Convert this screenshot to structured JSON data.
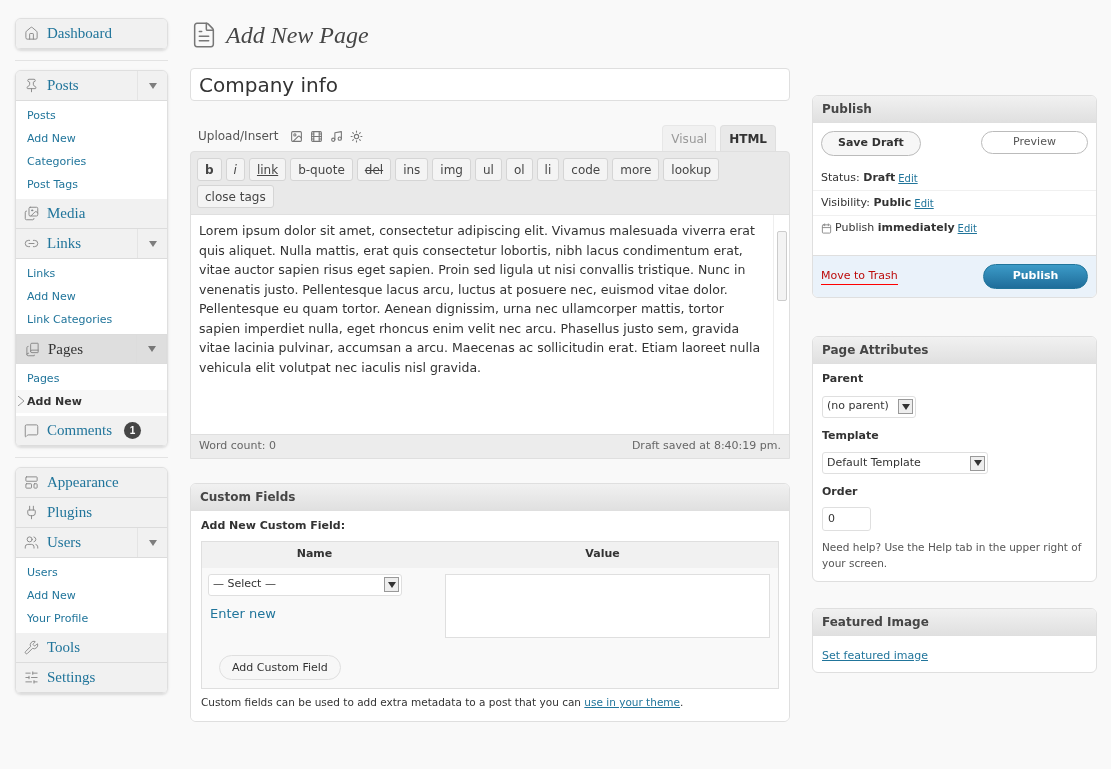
{
  "sidebar": {
    "groups": [
      [
        {
          "label": "Dashboard",
          "selected": false
        }
      ],
      [
        {
          "label": "Posts",
          "selected": false,
          "expanded": true,
          "children": [
            {
              "label": "Posts",
              "selected": false
            },
            {
              "label": "Add New",
              "selected": false
            },
            {
              "label": "Categories",
              "selected": false
            },
            {
              "label": "Post Tags",
              "selected": false
            }
          ]
        },
        {
          "label": "Media",
          "selected": false
        },
        {
          "label": "Links",
          "selected": false,
          "expanded": true,
          "children": [
            {
              "label": "Links",
              "selected": false
            },
            {
              "label": "Add New",
              "selected": false
            },
            {
              "label": "Link Categories",
              "selected": false
            }
          ]
        },
        {
          "label": "Pages",
          "selected": true,
          "expanded": true,
          "children": [
            {
              "label": "Pages",
              "selected": false
            },
            {
              "label": "Add New",
              "selected": true
            }
          ]
        },
        {
          "label": "Comments",
          "selected": false,
          "badge": "1"
        }
      ],
      [
        {
          "label": "Appearance",
          "selected": false
        },
        {
          "label": "Plugins",
          "selected": false
        },
        {
          "label": "Users",
          "selected": false,
          "expanded": true,
          "children": [
            {
              "label": "Users",
              "selected": false
            },
            {
              "label": "Add New",
              "selected": false
            },
            {
              "label": "Your Profile",
              "selected": false
            }
          ]
        },
        {
          "label": "Tools",
          "selected": false
        },
        {
          "label": "Settings",
          "selected": false
        }
      ]
    ]
  },
  "page_title": "Add New Page",
  "editor": {
    "title_value": "Company info",
    "upload_label": "Upload/Insert",
    "tabs": [
      {
        "label": "Visual",
        "selected": false
      },
      {
        "label": "HTML",
        "selected": true
      }
    ],
    "quicktags": [
      {
        "label": "b",
        "kind": "bold"
      },
      {
        "label": "i",
        "kind": "italic"
      },
      {
        "label": "link",
        "kind": "link"
      },
      {
        "label": "b-quote",
        "kind": "plain"
      },
      {
        "label": "del",
        "kind": "strike"
      },
      {
        "label": "ins",
        "kind": "plain"
      },
      {
        "label": "img",
        "kind": "plain"
      },
      {
        "label": "ul",
        "kind": "plain"
      },
      {
        "label": "ol",
        "kind": "plain"
      },
      {
        "label": "li",
        "kind": "plain"
      },
      {
        "label": "code",
        "kind": "plain"
      },
      {
        "label": "more",
        "kind": "plain"
      },
      {
        "label": "lookup",
        "kind": "plain"
      },
      {
        "label": "close tags",
        "kind": "plain"
      }
    ],
    "content": "Lorem ipsum dolor sit amet, consectetur adipiscing elit. Vivamus  malesuada viverra erat quis aliquet. Nulla mattis, erat quis consectetur  lobortis, nibh lacus condimentum erat, vitae auctor sapien risus eget  sapien. Proin sed ligula ut nisi convallis tristique. Nunc in venenatis  justo. Pellentesque lacus arcu, luctus at posuere nec, euismod vitae  dolor. Pellentesque eu quam tortor. Aenean dignissim, urna nec  ullamcorper mattis, tortor sapien imperdiet nulla, eget rhoncus enim  velit nec arcu. Phasellus justo sem, gravida vitae lacinia pulvinar,  accumsan a arcu. Maecenas ac sollicitudin erat. Etiam laoreet nulla vehicula elit volutpat nec iaculis nisl gravida.",
    "word_count": "Word count: 0",
    "draft_saved": "Draft saved at 8:40:19 pm."
  },
  "custom_fields": {
    "title": "Custom Fields",
    "subtitle": "Add New Custom Field:",
    "columns": [
      "Name",
      "Value"
    ],
    "select_value": "— Select —",
    "enter_new": "Enter new",
    "add_button": "Add Custom Field",
    "note": "Custom fields can be used to add extra metadata to a post that you can ",
    "note_link": "use in your theme",
    "note_end": "."
  },
  "publish": {
    "title": "Publish",
    "save_draft": "Save Draft",
    "preview": "Preview",
    "rows": [
      {
        "kind": "status",
        "text": "Status: **Draft**",
        "link": "Edit"
      },
      {
        "kind": "visibility",
        "text": "Visibility: **Public**",
        "link": "Edit"
      },
      {
        "kind": "schedule",
        "text": "Publish **immediately**",
        "link": "Edit"
      }
    ],
    "trash": "Move to Trash",
    "publish_button": "Publish"
  },
  "page_attributes": {
    "title": "Page Attributes",
    "parent_label": "Parent",
    "parent_value": "(no parent)",
    "template_label": "Template",
    "template_value": "Default Template",
    "order_label": "Order",
    "order_value": "0",
    "help": "Need help? Use the Help tab in the upper right of your screen."
  },
  "featured_image": {
    "title": "Featured Image",
    "link": "Set featured image"
  }
}
